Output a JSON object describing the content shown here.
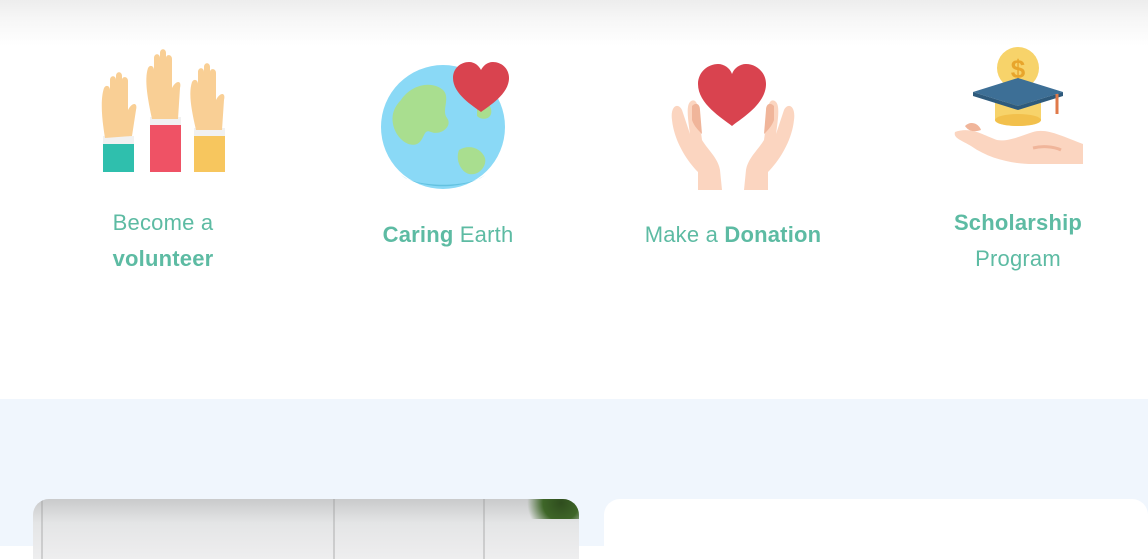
{
  "features": [
    {
      "icon": "raised-hands-icon",
      "caption_regular": "Become a",
      "caption_bold": "volunteer"
    },
    {
      "icon": "earth-heart-icon",
      "caption_bold": "Caring",
      "caption_regular": "Earth"
    },
    {
      "icon": "hands-heart-icon",
      "caption_regular": "Make a",
      "caption_bold": "Donation"
    },
    {
      "icon": "graduation-cap-hand-icon",
      "caption_bold": "Scholarship",
      "caption_regular": "Program"
    }
  ],
  "colors": {
    "accent_text": "#5dbba3",
    "section_bg": "#f0f6fd",
    "heart_red": "#d9434f"
  }
}
